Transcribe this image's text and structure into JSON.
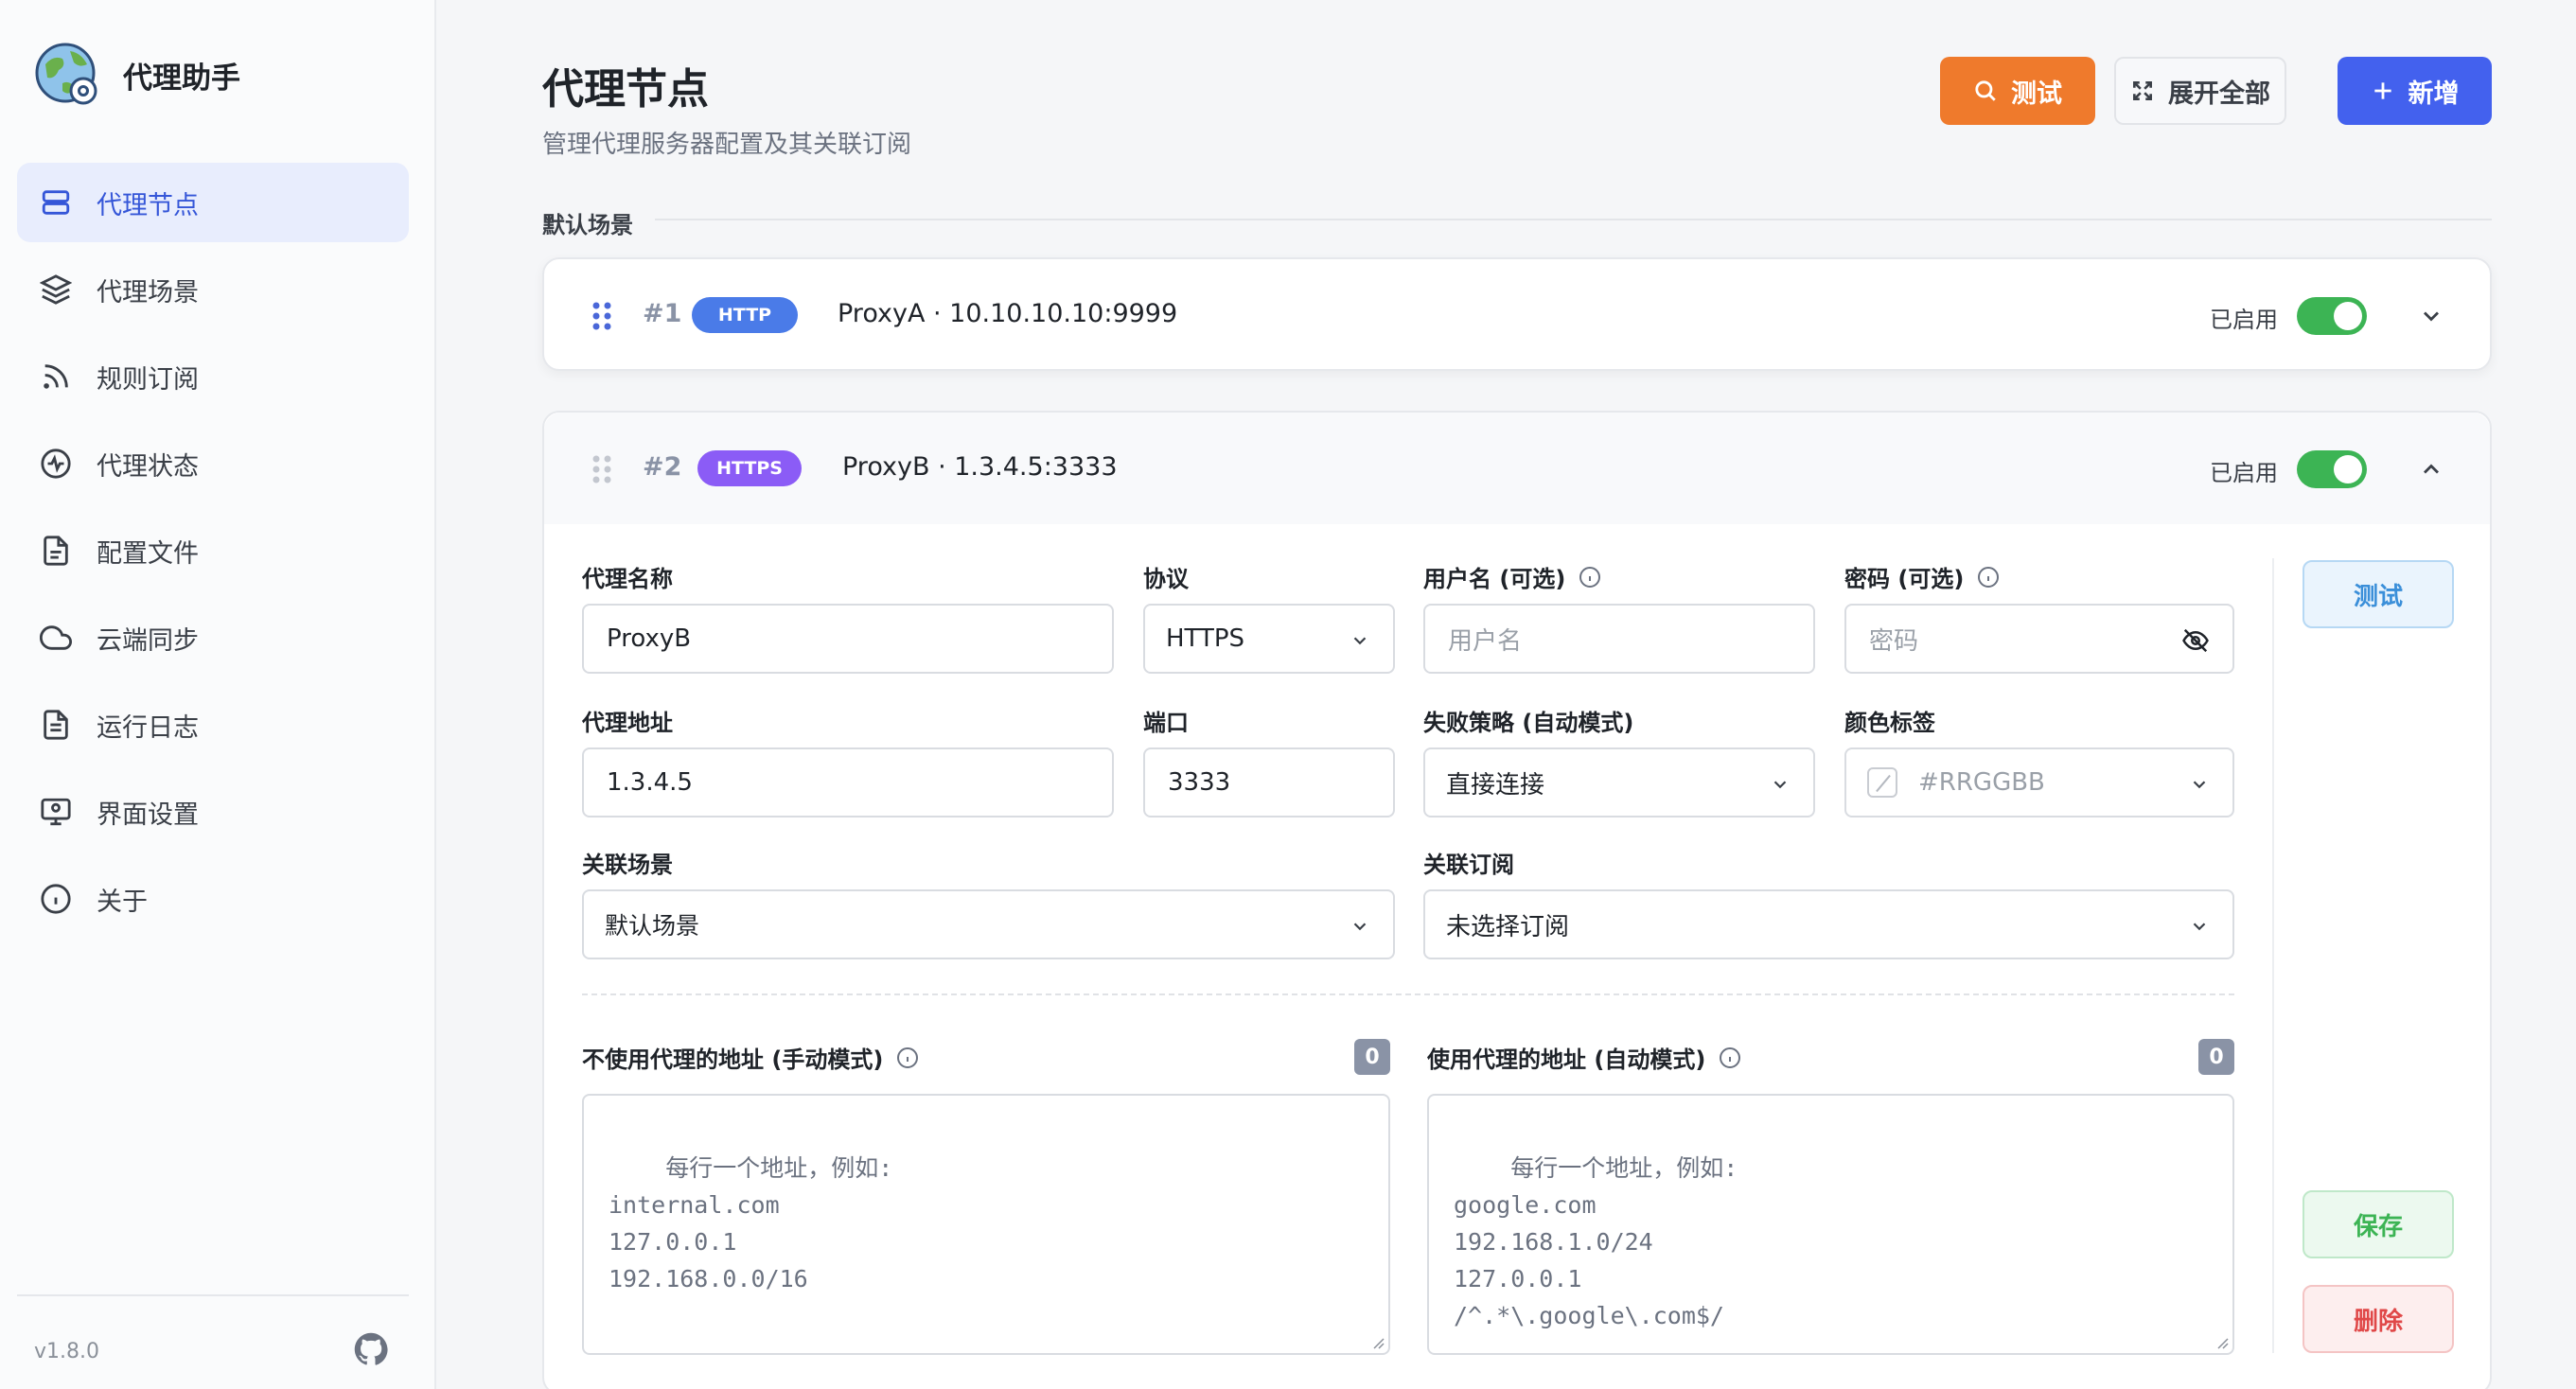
{
  "app": {
    "name": "代理助手",
    "version": "v1.8.0"
  },
  "sidebar": {
    "items": [
      {
        "label": "代理节点",
        "icon": "server-icon",
        "active": true
      },
      {
        "label": "代理场景",
        "icon": "layers-icon"
      },
      {
        "label": "规则订阅",
        "icon": "rss-icon"
      },
      {
        "label": "代理状态",
        "icon": "activity-icon"
      },
      {
        "label": "配置文件",
        "icon": "file-icon"
      },
      {
        "label": "云端同步",
        "icon": "cloud-icon"
      },
      {
        "label": "运行日志",
        "icon": "log-icon"
      },
      {
        "label": "界面设置",
        "icon": "monitor-icon"
      },
      {
        "label": "关于",
        "icon": "info-icon"
      }
    ]
  },
  "header": {
    "title": "代理节点",
    "subtitle": "管理代理服务器配置及其关联订阅",
    "test_label": "测试",
    "expand_label": "展开全部",
    "add_label": "新增"
  },
  "group": {
    "label": "默认场景"
  },
  "nodes": [
    {
      "index": "#1",
      "protocol": "HTTP",
      "title": "ProxyA · 10.10.10.10:9999",
      "status": "已启用",
      "enabled": true,
      "expanded": false
    },
    {
      "index": "#2",
      "protocol": "HTTPS",
      "title": "ProxyB · 1.3.4.5:3333",
      "status": "已启用",
      "enabled": true,
      "expanded": true
    }
  ],
  "form": {
    "name_label": "代理名称",
    "name_value": "ProxyB",
    "protocol_label": "协议",
    "protocol_value": "HTTPS",
    "username_label": "用户名 (可选)",
    "username_placeholder": "用户名",
    "password_label": "密码 (可选)",
    "password_placeholder": "密码",
    "address_label": "代理地址",
    "address_value": "1.3.4.5",
    "port_label": "端口",
    "port_value": "3333",
    "failure_label": "失败策略 (自动模式)",
    "failure_value": "直接连接",
    "color_label": "颜色标签",
    "color_placeholder": "#RRGGBB",
    "scene_label": "关联场景",
    "scene_value": "默认场景",
    "sub_label": "关联订阅",
    "sub_value": "未选择订阅",
    "bypass_label": "不使用代理的地址 (手动模式)",
    "bypass_count": "0",
    "bypass_placeholder": "每行一个地址，例如:\ninternal.com\n127.0.0.1\n192.168.0.0/16",
    "use_label": "使用代理的地址 (自动模式)",
    "use_count": "0",
    "use_placeholder": "每行一个地址，例如:\ngoogle.com\n192.168.1.0/24\n127.0.0.1\n/^.*\\.google\\.com$/",
    "test_label": "测试",
    "save_label": "保存",
    "delete_label": "删除"
  },
  "colors": {
    "accent": "#4361ee",
    "test": "#ef7a2c",
    "enabled": "#3cb454",
    "http": "#4a7be8",
    "https": "#8b5cf6"
  }
}
